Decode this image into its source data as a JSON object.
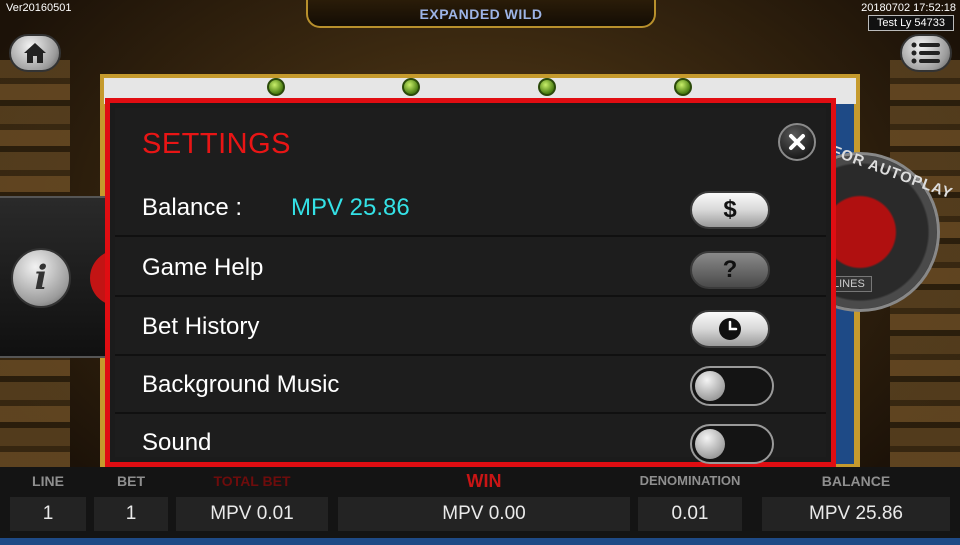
{
  "header": {
    "version": "Ver20160501",
    "datetime": "20180702 17:52:18",
    "user": "Test Ly 54733",
    "banner": "EXPANDED WILD"
  },
  "background": {
    "autoplay_label": "FOR AUTOPLAY",
    "lines_label": "LINES"
  },
  "settings": {
    "title": "SETTINGS",
    "rows": [
      {
        "label": "Balance :",
        "value": "MPV 25.86",
        "control": "dollar-button",
        "glyph": "$"
      },
      {
        "label": "Game Help",
        "control": "help-button",
        "glyph": "?"
      },
      {
        "label": "Bet History",
        "control": "history-button"
      },
      {
        "label": "Background Music",
        "control": "toggle",
        "state": "off"
      },
      {
        "label": "Sound",
        "control": "toggle",
        "state": "off"
      }
    ]
  },
  "bottom_bar": {
    "line": {
      "label": "LINE",
      "value": "1"
    },
    "bet": {
      "label": "BET",
      "value": "1"
    },
    "total_bet": {
      "label": "TOTAL BET",
      "value": "MPV 0.01"
    },
    "win": {
      "label": "WIN",
      "value": "MPV 0.00"
    },
    "denomination": {
      "label": "DENOMINATION",
      "value": "0.01"
    },
    "balance": {
      "label": "BALANCE",
      "value": "MPV 25.86"
    }
  },
  "colors": {
    "modal_border": "#e00d12",
    "title": "#e81515",
    "balance_value": "#34e1e6",
    "win_label": "#c91515"
  }
}
